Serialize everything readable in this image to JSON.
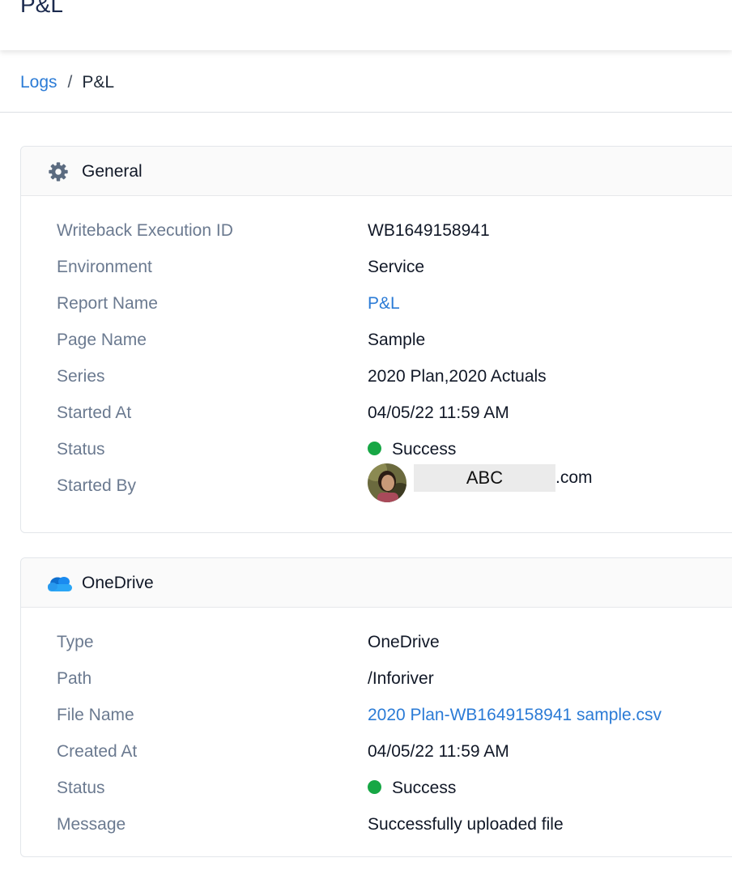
{
  "header": {
    "title": "P&L"
  },
  "breadcrumb": {
    "link": "Logs",
    "separator": "/",
    "current": "P&L"
  },
  "general": {
    "title": "General",
    "icon": "gear-icon",
    "rows": {
      "execution_id": {
        "label": "Writeback Execution ID",
        "value": "WB1649158941"
      },
      "environment": {
        "label": "Environment",
        "value": "Service"
      },
      "report_name": {
        "label": "Report Name",
        "value": "P&L"
      },
      "page_name": {
        "label": "Page Name",
        "value": "Sample"
      },
      "series": {
        "label": "Series",
        "value": "2020 Plan,2020 Actuals"
      },
      "started_at": {
        "label": "Started At",
        "value": "04/05/22 11:59 AM"
      },
      "status": {
        "label": "Status",
        "value": "Success"
      },
      "started_by": {
        "label": "Started By",
        "redacted": "ABC",
        "domain": ".com"
      }
    }
  },
  "onedrive": {
    "title": "OneDrive",
    "icon": "onedrive-cloud-icon",
    "rows": {
      "type": {
        "label": "Type",
        "value": "OneDrive"
      },
      "path": {
        "label": "Path",
        "value": "/Inforiver"
      },
      "file_name": {
        "label": "File Name",
        "value": "2020 Plan-WB1649158941 sample.csv"
      },
      "created_at": {
        "label": "Created At",
        "value": "04/05/22 11:59 AM"
      },
      "status": {
        "label": "Status",
        "value": "Success"
      },
      "message": {
        "label": "Message",
        "value": "Successfully uploaded file"
      }
    }
  },
  "colors": {
    "link": "#2b7bd6",
    "label": "#6b7a90",
    "success": "#17a745",
    "title": "#1b2a4e"
  }
}
